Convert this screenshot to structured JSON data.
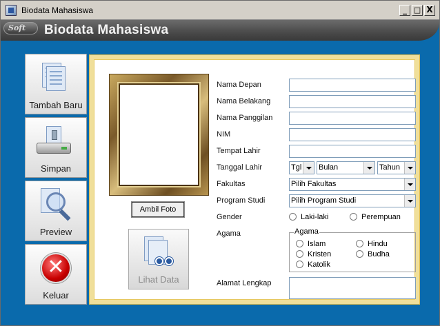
{
  "window": {
    "title": "Biodata Mahasiswa",
    "controls": {
      "minimize": "_",
      "maximize": "□",
      "close": "X"
    }
  },
  "header": {
    "logo_text": "Soft",
    "title": "Biodata Mahasiswa"
  },
  "sidebar": {
    "items": [
      {
        "label": "Tambah Baru",
        "icon": "document-stack-icon"
      },
      {
        "label": "Simpan",
        "icon": "save-drive-icon"
      },
      {
        "label": "Preview",
        "icon": "magnifier-document-icon"
      },
      {
        "label": "Keluar",
        "icon": "exit-x-icon"
      }
    ]
  },
  "photo": {
    "button_label": "Ambil Foto",
    "view_button_label": "Lihat Data"
  },
  "form": {
    "nama_depan": {
      "label": "Nama Depan",
      "value": ""
    },
    "nama_belakang": {
      "label": "Nama Belakang",
      "value": ""
    },
    "nama_panggilan": {
      "label": "Nama Panggilan",
      "value": ""
    },
    "nim": {
      "label": "NIM",
      "value": ""
    },
    "tempat_lahir": {
      "label": "Tempat Lahir",
      "value": ""
    },
    "tanggal_lahir": {
      "label": "Tanggal Lahir",
      "day": "Tgl",
      "month": "Bulan",
      "year": "Tahun"
    },
    "fakultas": {
      "label": "Fakultas",
      "value": "Pilih Fakultas"
    },
    "program_studi": {
      "label": "Program Studi",
      "value": "Pilih Program Studi"
    },
    "gender": {
      "label": "Gender",
      "options": [
        "Laki-laki",
        "Perempuan"
      ]
    },
    "agama": {
      "label": "Agama",
      "group_title": "Agama",
      "options": [
        "Islam",
        "Hindu",
        "Kristen",
        "Budha",
        "Katolik"
      ]
    },
    "alamat": {
      "label": "Alamat Lengkap",
      "value": ""
    }
  },
  "colors": {
    "background_blue": "#0a6aac",
    "panel_border_gold": "#f0df9a",
    "header_gray": "#4a4a4a"
  }
}
